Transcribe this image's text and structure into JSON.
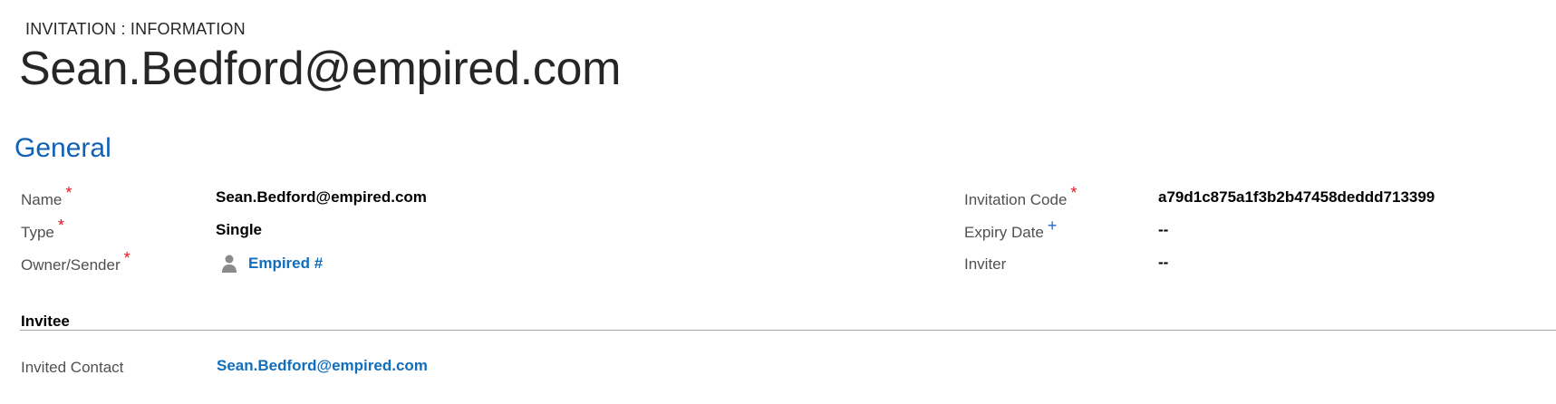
{
  "header": {
    "entity_type": "INVITATION : INFORMATION",
    "record_title": "Sean.Bedford@empired.com"
  },
  "general": {
    "section_title": "General",
    "name_label": "Name",
    "name_value": "Sean.Bedford@empired.com",
    "type_label": "Type",
    "type_value": "Single",
    "owner_label": "Owner/Sender",
    "owner_value": "Empired #",
    "invitation_code_label": "Invitation Code",
    "invitation_code_value": "a79d1c875a1f3b2b47458deddd713399",
    "expiry_date_label": "Expiry Date",
    "expiry_date_value": "--",
    "inviter_label": "Inviter",
    "inviter_value": "--",
    "required_marker": "*",
    "recommended_marker": "+"
  },
  "invitee": {
    "section_title": "Invitee",
    "invited_contact_label": "Invited Contact",
    "invited_contact_value": "Sean.Bedford@empired.com"
  },
  "icons": {
    "owner_icon": "person-icon"
  },
  "colors": {
    "section_title": "#1160b7",
    "link": "#106ebe",
    "required": "#e8141f",
    "recommended": "#2266cc"
  }
}
